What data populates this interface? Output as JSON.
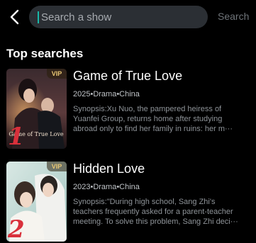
{
  "header": {
    "search_placeholder": "Search a show",
    "search_button": "Search"
  },
  "section": {
    "title": "Top searches"
  },
  "results": [
    {
      "title": "Game of True Love",
      "badge": "VIP",
      "rank": "1",
      "poster_caption": "Game of True Love",
      "meta": "2025•Drama•China",
      "synopsis_lines": [
        "Synopsis:Xu Nuo, the pampered heiress of",
        "Yuanfei Group, returns home after studying",
        "abroad only to find her family in ruins: her m···"
      ]
    },
    {
      "title": "Hidden Love",
      "badge": "VIP",
      "rank": "2",
      "meta": "2023•Drama•China",
      "synopsis_lines": [
        "Synopsis:\"During high school, Sang Zhi's",
        "teachers frequently asked for a parent-teacher",
        "meeting. To solve this problem, Sang Zhi deci···"
      ]
    }
  ],
  "colors": {
    "background": "#000000",
    "search_field": "#2b2f34",
    "caret": "#19b8a8",
    "vip_text": "#e9c874",
    "rank": "#d9303b"
  }
}
